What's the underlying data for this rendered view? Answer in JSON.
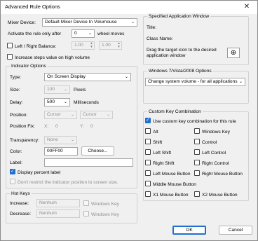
{
  "window": {
    "title": "Advanced Rule Options",
    "close_glyph": "✕"
  },
  "main": {
    "mixer_device_label": "Mixer Device:",
    "mixer_device_value": "Default Mixer Device In Volumouse",
    "activate_label_pre": "Activate the rule only after",
    "activate_value": "0",
    "activate_label_post": "wheel moves",
    "lr_balance_label": "Left / Right Balance:",
    "lr_left_value": "1.00",
    "lr_right_value": "1.00",
    "increase_steps_label": "Increase steps value on high volume"
  },
  "indicator": {
    "group_title": "Indicator Options",
    "type_label": "Type:",
    "type_value": "On Screen Display",
    "size_label": "Size:",
    "size_value": "100",
    "size_unit": "Pixels",
    "delay_label": "Delay:",
    "delay_value": "500",
    "delay_unit": "Milliseconds",
    "position_label": "Position:",
    "position_x_value": "Cursor",
    "position_y_value": "Cursor",
    "position_fix_label": "Position Fix:",
    "fix_x_label": "X:",
    "fix_x_value": "0",
    "fix_y_label": "Y:",
    "fix_y_value": "0",
    "transparency_label": "Transparency:",
    "transparency_value": "None",
    "color_label": "Color:",
    "color_value": "00FF00",
    "choose_button": "Choose...",
    "label_label": "Label:",
    "label_value": "",
    "display_percent_label": "Display percent label",
    "dont_restrict_label": "Don't restrict the indicator position to screen size."
  },
  "hotkeys": {
    "group_title": "Hot Keys",
    "increase_label": "Increase:",
    "increase_value": "Nenhum",
    "increase_winkey": "Windows Key",
    "decrease_label": "Decrease:",
    "decrease_value": "Nenhum",
    "decrease_winkey": "Windows Key"
  },
  "specified_app": {
    "group_title": "Specified Application Window",
    "title_label": "Title:",
    "class_label": "Class Name:",
    "drag_text_1": "Drag the target icon to the desired",
    "drag_text_2": "application window",
    "target_icon": "⊕"
  },
  "win7": {
    "group_title": "Windows 7/Vista/2008 Options",
    "value": "Change system volume - for all applications"
  },
  "custom_key": {
    "group_title": "Custom Key Combination",
    "use_custom_label": "Use custom key combination for this rule",
    "alt": "Alt",
    "windows_key": "Windows Key",
    "shift": "Shift",
    "control": "Control",
    "left_shift": "Left Shift",
    "left_control": "Left Control",
    "right_shift": "Right Shift",
    "right_control": "Right Control",
    "left_mouse": "Left Mouse Button",
    "right_mouse": "Right Mouse Button",
    "middle_mouse": "Middle Mouse Button",
    "x1_mouse": "X1 Mouse Button",
    "x2_mouse": "X2 Mouse Button"
  },
  "footer": {
    "ok": "OK",
    "cancel": "Cancel"
  },
  "colors": {
    "accent": "#1e6fd0",
    "disabled_text": "#8d8d8d"
  }
}
